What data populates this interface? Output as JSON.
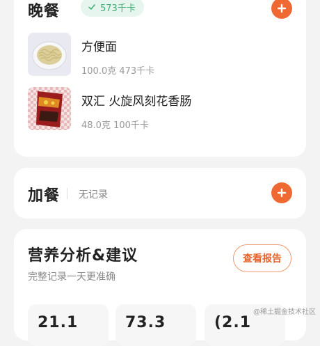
{
  "dinner": {
    "title": "晚餐",
    "calories_badge": "573千卡",
    "items": [
      {
        "name": "方便面",
        "amount": "100.0克 473千卡"
      },
      {
        "name": "双汇 火旋风刻花香肠",
        "amount": "48.0克 100千卡"
      }
    ]
  },
  "snack": {
    "title": "加餐",
    "empty_text": "无记录"
  },
  "nutrition": {
    "title": "营养分析&建议",
    "subtitle": "完整记录一天更准确",
    "report_button": "查看报告",
    "stats": [
      "21.1",
      "73.3",
      "(2.1"
    ]
  },
  "watermark": "@稀土掘金技术社区",
  "colors": {
    "accent": "#ef6a32",
    "badge_bg": "#e6f6ee",
    "badge_text": "#3fae73",
    "page_bg": "#f3f3f3"
  },
  "icons": {
    "add": "plus-icon",
    "badge": "check-icon"
  }
}
